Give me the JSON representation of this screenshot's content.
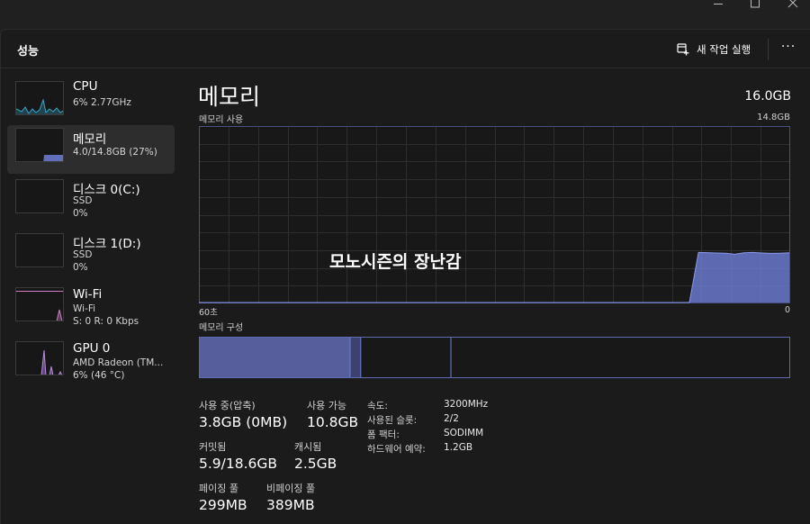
{
  "window": {
    "controls": [
      "minimize",
      "maximize",
      "close"
    ]
  },
  "header": {
    "title": "성능",
    "new_task_label": "새 작업 실행",
    "more_label": "···",
    "icons": {
      "new_task": "new-task-icon",
      "more": "more-icon"
    }
  },
  "sidebar": {
    "items": [
      {
        "title": "CPU",
        "line1": "6% 2.77GHz",
        "line2": "",
        "line3": "",
        "color": "#3aa6c9",
        "active": false
      },
      {
        "title": "메모리",
        "line1": "4.0/14.8GB (27%)",
        "line2": "",
        "line3": "",
        "color": "#7480e0",
        "active": true
      },
      {
        "title": "디스크 0(C:)",
        "line1": "SSD",
        "line2": "0%",
        "line3": "",
        "color": "#3fa08a",
        "active": false
      },
      {
        "title": "디스크 1(D:)",
        "line1": "SSD",
        "line2": "0%",
        "line3": "",
        "color": "#3fa08a",
        "active": false
      },
      {
        "title": "Wi-Fi",
        "line1": "Wi-Fi",
        "line2": "S: 0  R: 0 Kbps",
        "line3": "",
        "color": "#d07fc7",
        "active": false
      },
      {
        "title": "GPU 0",
        "line1": "AMD Radeon (TM...",
        "line2": "6% (46 °C)",
        "line3": "",
        "color": "#b88ae0",
        "active": false
      }
    ]
  },
  "main": {
    "title": "메모리",
    "total": "16.0GB",
    "graph_label": "메모리 사용",
    "graph_max": "14.8GB",
    "x_left": "60초",
    "x_right": "0",
    "watermark": "모노시즌의 장난감",
    "composition_label": "메모리 구성",
    "composition": {
      "in_use_fraction": 0.255,
      "modified_fraction": 0.018,
      "standby_fraction": 0.153,
      "free_fraction": 0.574
    },
    "accent_color": "#6f7fd8",
    "usage_history_percent": [
      0,
      0,
      0,
      0,
      0,
      0,
      0,
      0,
      0,
      0,
      0,
      0,
      0,
      0,
      0,
      0,
      0,
      0,
      0,
      0,
      0,
      0,
      0,
      0,
      0,
      0,
      0,
      0,
      0,
      0,
      0,
      0,
      0,
      0,
      0,
      0,
      0,
      0,
      0,
      0,
      0,
      0,
      0,
      0,
      0,
      0,
      0,
      0,
      0,
      0,
      0,
      0,
      0,
      0,
      0,
      28.5,
      28.4,
      28.2,
      28.1,
      27.5,
      28.3,
      28.5,
      28.2,
      28.0,
      28.1,
      28.3
    ]
  },
  "stats": {
    "in_use_label": "사용 중(압축)",
    "in_use_value": "3.8GB (0MB)",
    "available_label": "사용 가능",
    "available_value": "10.8GB",
    "committed_label": "커밋됨",
    "committed_value": "5.9/18.6GB",
    "cached_label": "캐시됨",
    "cached_value": "2.5GB",
    "paged_label": "페이징 풀",
    "paged_value": "299MB",
    "nonpaged_label": "비페이징 풀",
    "nonpaged_value": "389MB"
  },
  "properties": [
    {
      "label": "속도:",
      "value": "3200MHz"
    },
    {
      "label": "사용된 슬롯:",
      "value": "2/2"
    },
    {
      "label": "폼 팩터:",
      "value": "SODIMM"
    },
    {
      "label": "하드웨어 예약:",
      "value": "1.2GB"
    }
  ]
}
